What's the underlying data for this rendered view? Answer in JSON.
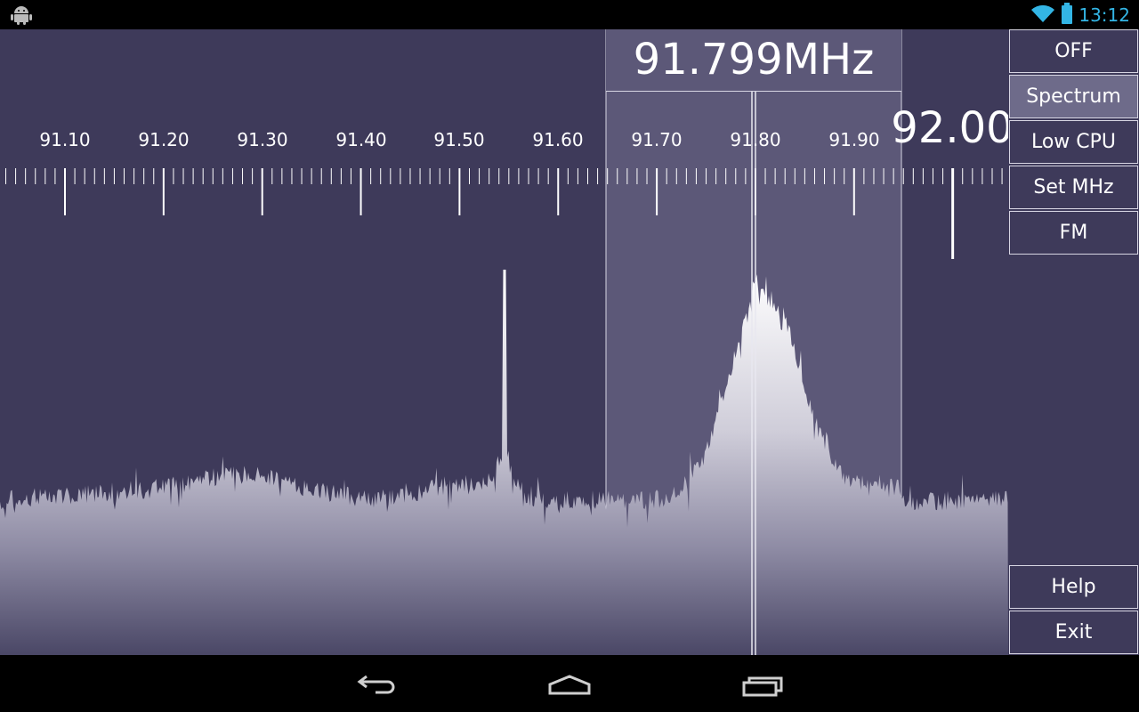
{
  "status_bar": {
    "clock": "13:12",
    "icons": [
      "android-icon",
      "wifi-icon",
      "battery-icon"
    ],
    "accent_color": "#33b5e5"
  },
  "tuner": {
    "frequency_display": "91.799MHz",
    "scale_labels": [
      "91.10",
      "91.20",
      "91.30",
      "91.40",
      "91.50",
      "91.60",
      "91.70",
      "91.80",
      "91.90"
    ],
    "scale_big_label": "92.00"
  },
  "sidebar": {
    "buttons": [
      {
        "label": "OFF",
        "active": false
      },
      {
        "label": "Spectrum",
        "active": true
      },
      {
        "label": "Low CPU",
        "active": false
      },
      {
        "label": "Set MHz",
        "active": false
      },
      {
        "label": "FM",
        "active": false
      }
    ],
    "bottom_buttons": [
      {
        "label": "Help"
      },
      {
        "label": "Exit"
      }
    ]
  },
  "navbar": {
    "buttons": [
      "back-icon",
      "home-icon",
      "recent-apps-icon"
    ]
  },
  "colors": {
    "background": "#3e3a5a",
    "highlight": "#5c5878",
    "active_button": "#6e6b8a",
    "border": "#d7d5e3"
  }
}
